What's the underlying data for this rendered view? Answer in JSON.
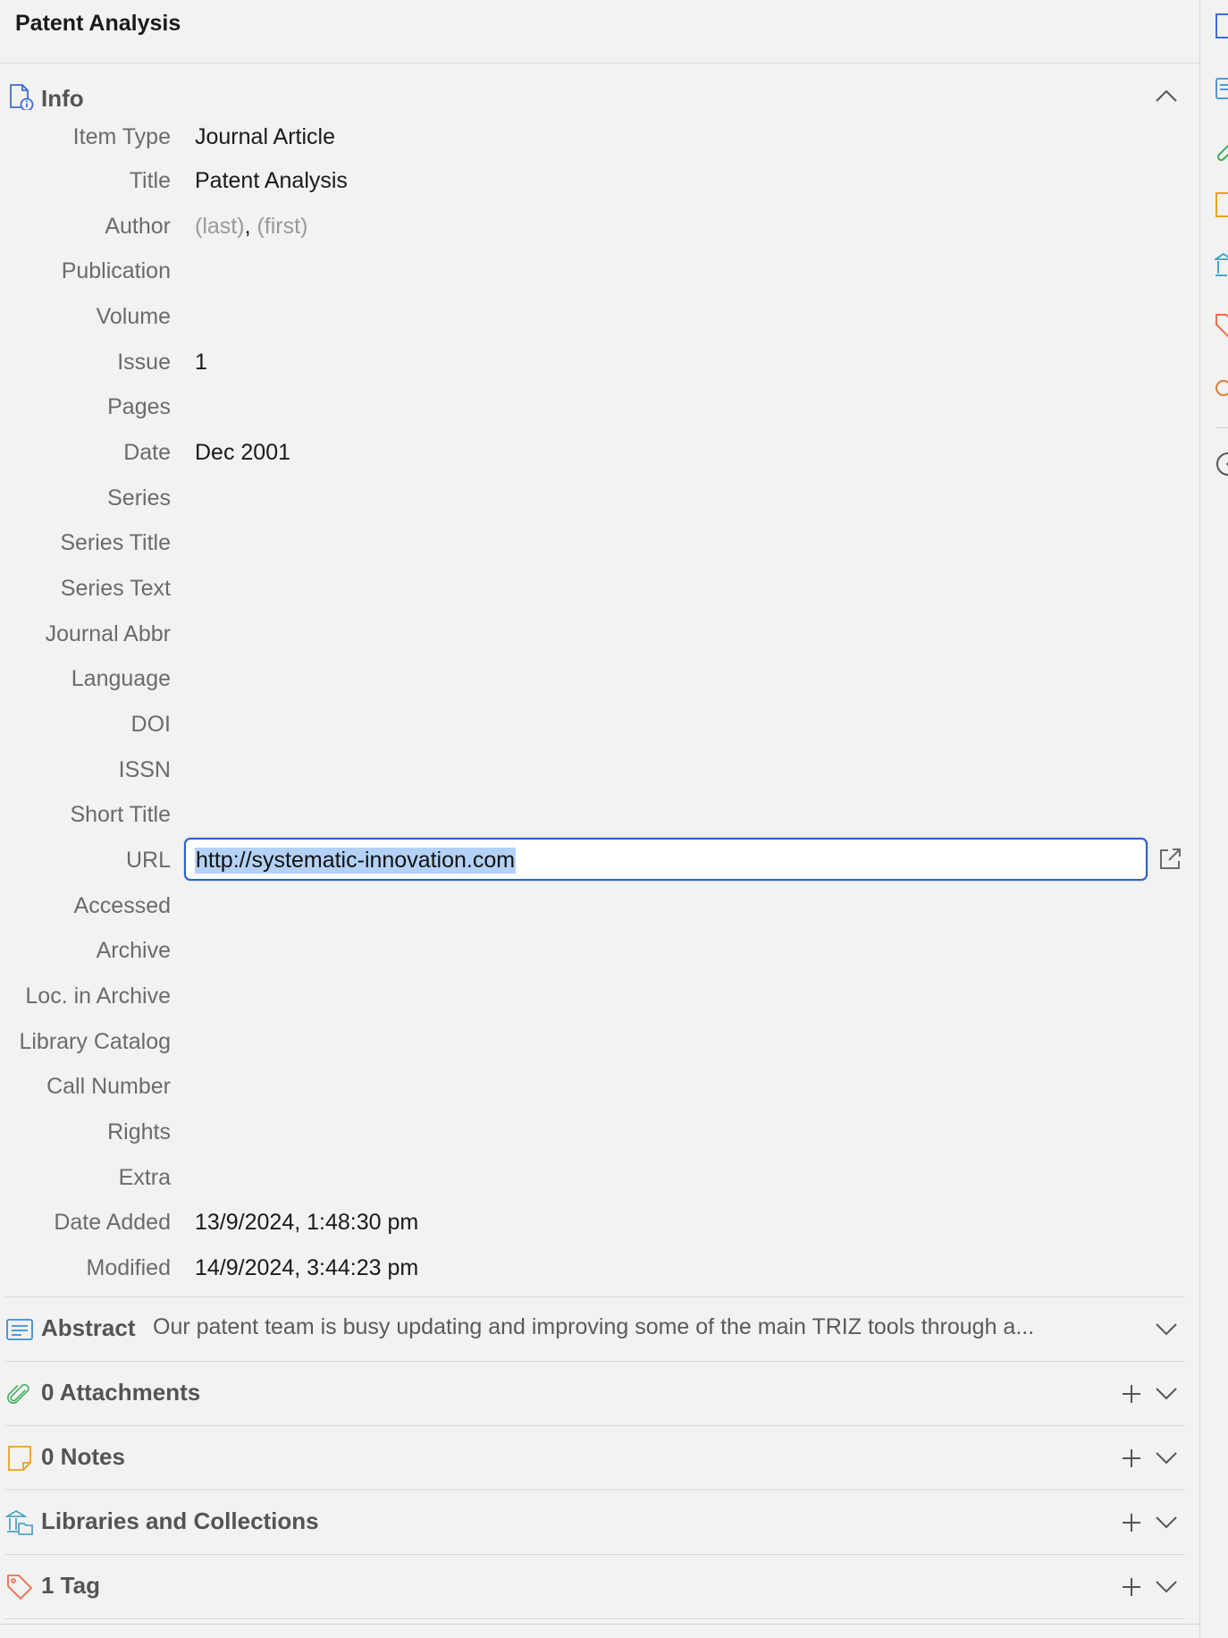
{
  "header": {
    "title": "Patent Analysis"
  },
  "info": {
    "label": "Info",
    "fields": [
      {
        "label": "Item Type",
        "value": "Journal Article"
      },
      {
        "label": "Title",
        "value": "Patent Analysis"
      },
      {
        "label": "Author",
        "value": ""
      },
      {
        "label": "Publication",
        "value": ""
      },
      {
        "label": "Volume",
        "value": ""
      },
      {
        "label": "Issue",
        "value": "1"
      },
      {
        "label": "Pages",
        "value": ""
      },
      {
        "label": "Date",
        "value": "Dec 2001"
      },
      {
        "label": "Series",
        "value": ""
      },
      {
        "label": "Series Title",
        "value": ""
      },
      {
        "label": "Series Text",
        "value": ""
      },
      {
        "label": "Journal Abbr",
        "value": ""
      },
      {
        "label": "Language",
        "value": ""
      },
      {
        "label": "DOI",
        "value": ""
      },
      {
        "label": "ISSN",
        "value": ""
      },
      {
        "label": "Short Title",
        "value": ""
      },
      {
        "label": "URL",
        "value": ""
      },
      {
        "label": "Accessed",
        "value": ""
      },
      {
        "label": "Archive",
        "value": ""
      },
      {
        "label": "Loc. in Archive",
        "value": ""
      },
      {
        "label": "Library Catalog",
        "value": ""
      },
      {
        "label": "Call Number",
        "value": ""
      },
      {
        "label": "Rights",
        "value": ""
      },
      {
        "label": "Extra",
        "value": ""
      },
      {
        "label": "Date Added",
        "value": "13/9/2024, 1:48:30 pm"
      },
      {
        "label": "Modified",
        "value": "14/9/2024, 3:44:23 pm"
      }
    ],
    "author": {
      "last_placeholder": "(last)",
      "separator": ",",
      "first_placeholder": "(first)"
    },
    "url": {
      "value": "http://systematic-innovation.com"
    }
  },
  "sections": {
    "abstract": {
      "label": "Abstract",
      "text": "Our patent team is busy updating and improving some of the main TRIZ tools through a..."
    },
    "attachments": {
      "label": "0 Attachments"
    },
    "notes": {
      "label": "0 Notes"
    },
    "libraries": {
      "label": "Libraries and Collections"
    },
    "tags": {
      "label": "1 Tag"
    }
  },
  "colors": {
    "info": "#3b6fd6",
    "abstract": "#3b8fd6",
    "attachments": "#3fae57",
    "notes": "#f0a020",
    "libraries": "#3a9bc4",
    "tags": "#ee6b47",
    "related": "#e37a3a",
    "focus": "#2c5fcf"
  },
  "icons": {
    "info": "info-document-icon",
    "abstract": "abstract-icon",
    "attachments": "paperclip-icon",
    "notes": "note-icon",
    "libraries": "library-icon",
    "tags": "tag-icon",
    "open_link": "open-external-icon"
  }
}
